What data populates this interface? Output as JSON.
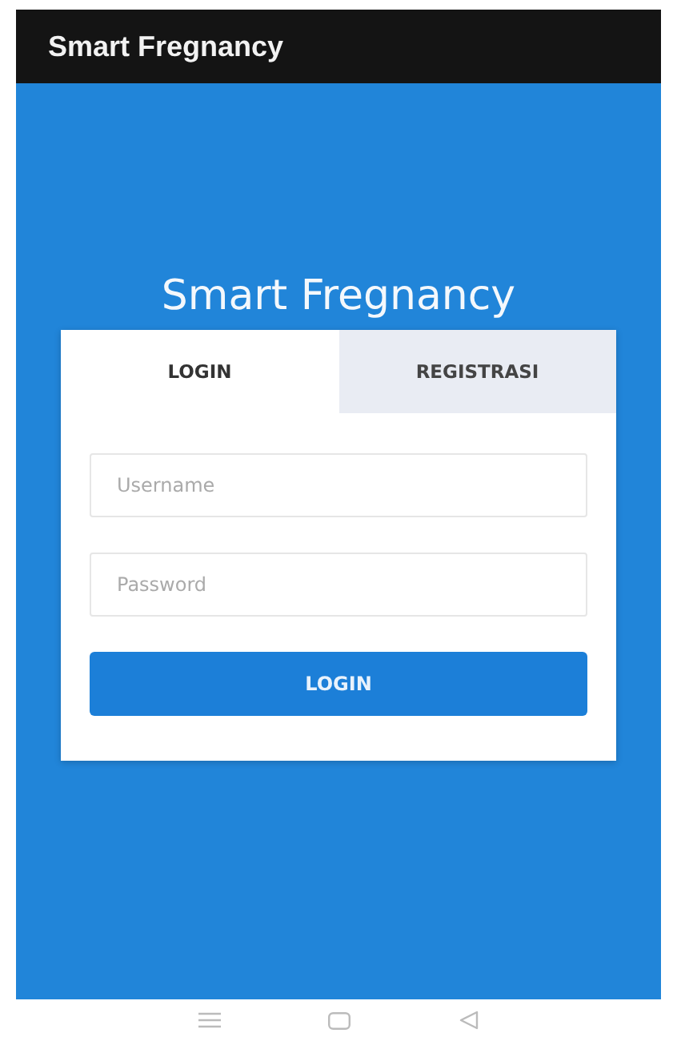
{
  "app_bar": {
    "title": "Smart Fregnancy"
  },
  "heading": "Smart Fregnancy",
  "tabs": [
    {
      "label": "LOGIN",
      "selected": true
    },
    {
      "label": "REGISTRASI",
      "selected": false
    }
  ],
  "fields": [
    {
      "placeholder": "Username"
    },
    {
      "placeholder": "Password"
    }
  ],
  "submit": "LOGIN"
}
